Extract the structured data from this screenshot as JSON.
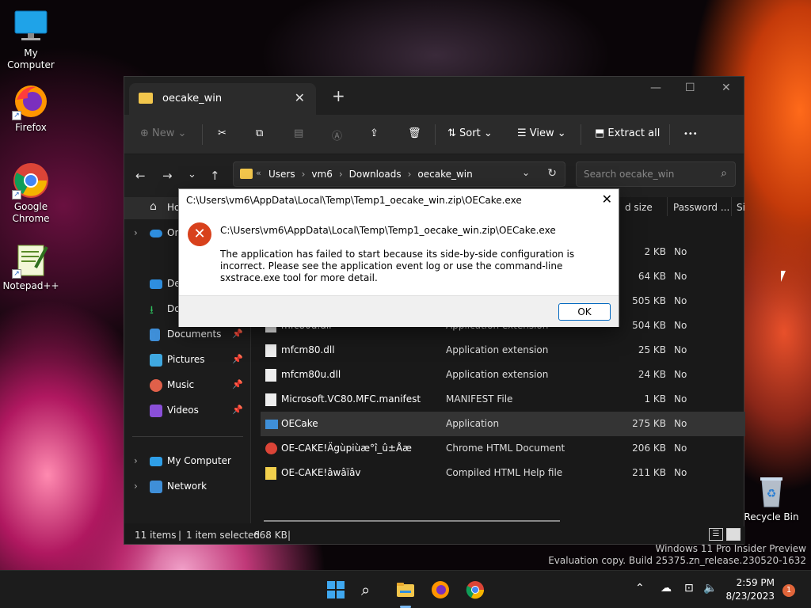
{
  "desktop": {
    "icons": [
      {
        "label": "My Computer"
      },
      {
        "label": "Firefox"
      },
      {
        "label": "Google Chrome"
      },
      {
        "label": "Notepad++"
      },
      {
        "label": "Recycle Bin"
      }
    ]
  },
  "explorer": {
    "tab_title": "oecake_win",
    "toolbar": {
      "new_label": "New",
      "sort_label": "Sort",
      "view_label": "View",
      "extract_label": "Extract all",
      "more_label": "•••"
    },
    "breadcrumbs": [
      "Users",
      "vm6",
      "Downloads",
      "oecake_win"
    ],
    "search_placeholder": "Search oecake_win",
    "sidebar": [
      {
        "label": "Ho"
      },
      {
        "label": "On"
      },
      {
        "label": "De"
      },
      {
        "label": "Do"
      },
      {
        "label": "Documents"
      },
      {
        "label": "Pictures"
      },
      {
        "label": "Music"
      },
      {
        "label": "Videos"
      },
      {
        "label": "My Computer"
      },
      {
        "label": "Network"
      }
    ],
    "columns": {
      "size": "d size",
      "password": "Password ...",
      "extra": "Si"
    },
    "rows": [
      {
        "name": "",
        "type": "",
        "size": "2 KB",
        "password": "No"
      },
      {
        "name": "",
        "type": "",
        "size": "64 KB",
        "password": "No"
      },
      {
        "name": "",
        "type": "",
        "size": "505 KB",
        "password": "No"
      },
      {
        "name": "mfc80u.dll",
        "type": "Application extension",
        "size": "504 KB",
        "password": "No"
      },
      {
        "name": "mfcm80.dll",
        "type": "Application extension",
        "size": "25 KB",
        "password": "No"
      },
      {
        "name": "mfcm80u.dll",
        "type": "Application extension",
        "size": "24 KB",
        "password": "No"
      },
      {
        "name": "Microsoft.VC80.MFC.manifest",
        "type": "MANIFEST File",
        "size": "1 KB",
        "password": "No"
      },
      {
        "name": "OECake",
        "type": "Application",
        "size": "275 KB",
        "password": "No"
      },
      {
        "name": "OE-CAKE!Ägùpiùæ°î_û±Åæ",
        "type": "Chrome HTML Document",
        "size": "206 KB",
        "password": "No"
      },
      {
        "name": "OE-CAKE!âwâïâv",
        "type": "Compiled HTML Help file",
        "size": "211 KB",
        "password": "No"
      }
    ],
    "status": {
      "items": "11 items",
      "selected": "1 item selected",
      "size": "668 KB"
    }
  },
  "dialog": {
    "title": "C:\\Users\\vm6\\AppData\\Local\\Temp\\Temp1_oecake_win.zip\\OECake.exe",
    "path": "C:\\Users\\vm6\\AppData\\Local\\Temp\\Temp1_oecake_win.zip\\OECake.exe",
    "message": "The application has failed to start because its side-by-side configuration is incorrect. Please see the application event log or use the command-line sxstrace.exe tool for more detail.",
    "ok_label": "OK"
  },
  "watermark": {
    "line1": "Windows 11 Pro Insider Preview",
    "line2": "Evaluation copy. Build 25375.zn_release.230520-1632"
  },
  "taskbar": {
    "time": "2:59 PM",
    "date": "8/23/2023",
    "notifications": "1"
  }
}
